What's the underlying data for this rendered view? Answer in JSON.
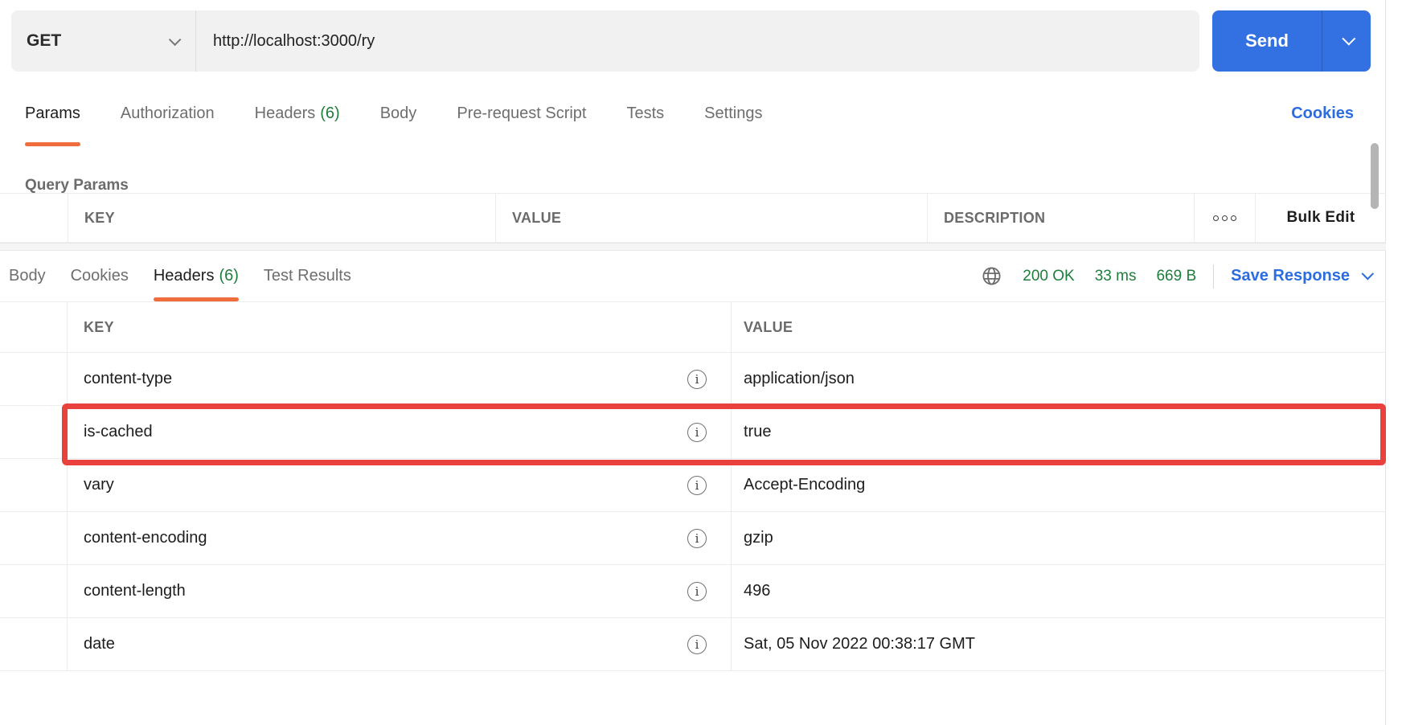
{
  "request_bar": {
    "method": "GET",
    "url": "http://localhost:3000/ry",
    "send_label": "Send"
  },
  "request_tabs": {
    "items": [
      {
        "label": "Params",
        "active": true
      },
      {
        "label": "Authorization"
      },
      {
        "label": "Headers",
        "count": "(6)"
      },
      {
        "label": "Body"
      },
      {
        "label": "Pre-request Script"
      },
      {
        "label": "Tests"
      },
      {
        "label": "Settings"
      }
    ],
    "cookies_link": "Cookies"
  },
  "query_params": {
    "title": "Query Params",
    "columns": {
      "key": "KEY",
      "value": "VALUE",
      "description": "DESCRIPTION"
    },
    "bulk_edit_label": "Bulk Edit"
  },
  "response": {
    "tabs": [
      {
        "label": "Body"
      },
      {
        "label": "Cookies"
      },
      {
        "label": "Headers",
        "count": "(6)",
        "active": true
      },
      {
        "label": "Test Results"
      }
    ],
    "status": {
      "code": "200 OK",
      "time": "33 ms",
      "size": "669 B"
    },
    "save_response_label": "Save Response",
    "table": {
      "columns": {
        "key": "KEY",
        "value": "VALUE"
      },
      "rows": [
        {
          "key": "content-type",
          "value": "application/json"
        },
        {
          "key": "is-cached",
          "value": "true",
          "highlighted": true
        },
        {
          "key": "vary",
          "value": "Accept-Encoding"
        },
        {
          "key": "content-encoding",
          "value": "gzip"
        },
        {
          "key": "content-length",
          "value": "496"
        },
        {
          "key": "date",
          "value": "Sat, 05 Nov 2022 00:38:17 GMT"
        }
      ]
    }
  },
  "icons": {
    "info_glyph": "i"
  },
  "colors": {
    "accent_orange": "#ef6c3b",
    "primary_blue": "#3371e3",
    "link_blue": "#2b6de0",
    "success_green": "#1e7e3c",
    "highlight_red": "#e8413e"
  }
}
